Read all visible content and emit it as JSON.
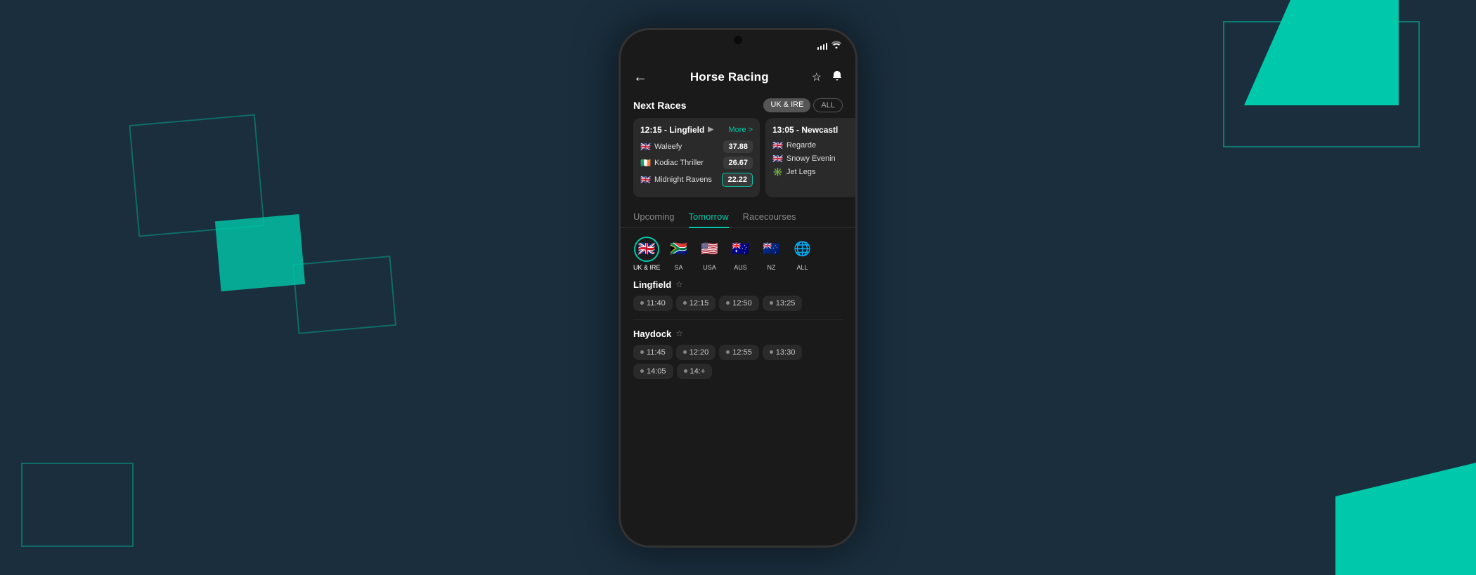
{
  "background": {
    "color": "#1a2e3d"
  },
  "app": {
    "title": "Horse Racing",
    "back_label": "←",
    "star_icon": "☆",
    "bell_icon": "🔔"
  },
  "next_races": {
    "title": "Next Races",
    "filters": [
      {
        "label": "UK & IRE",
        "active": true
      },
      {
        "label": "ALL",
        "active": false
      }
    ],
    "cards": [
      {
        "time_venue": "12:15 - Lingfield",
        "more_label": "More >",
        "horses": [
          {
            "name": "Waleefy",
            "odds": "37.88",
            "flag": "🇬🇧",
            "highlighted": false
          },
          {
            "name": "Kodiac Thriller",
            "odds": "26.67",
            "flag": "🇮🇪",
            "highlighted": false
          },
          {
            "name": "Midnight Ravens",
            "odds": "22.22",
            "flag": "🇬🇧",
            "highlighted": true
          }
        ]
      },
      {
        "time_venue": "13:05 - Newcastl",
        "more_label": "",
        "horses": [
          {
            "name": "Regarde",
            "odds": "",
            "flag": "🇬🇧",
            "highlighted": false
          },
          {
            "name": "Snowy Evenin",
            "odds": "",
            "flag": "🇬🇧",
            "highlighted": false
          },
          {
            "name": "Jet Legs",
            "odds": "",
            "flag": "✳️",
            "highlighted": false
          }
        ]
      }
    ]
  },
  "main_tabs": [
    {
      "label": "Upcoming",
      "active": false
    },
    {
      "label": "Tomorrow",
      "active": true
    },
    {
      "label": "Racecourses",
      "active": false
    }
  ],
  "country_filters": [
    {
      "label": "UK & IRE",
      "flag": "🇬🇧",
      "selected": true
    },
    {
      "label": "SA",
      "flag": "🇿🇦",
      "selected": false
    },
    {
      "label": "USA",
      "flag": "🇺🇸",
      "selected": false
    },
    {
      "label": "AUS",
      "flag": "🇦🇺",
      "selected": false
    },
    {
      "label": "NZ",
      "flag": "🇳🇿",
      "selected": false
    },
    {
      "label": "ALL",
      "flag": "🌐",
      "selected": false
    }
  ],
  "racecourses": [
    {
      "name": "Lingfield",
      "times": [
        "11:40",
        "12:15",
        "12:50",
        "13:25"
      ]
    },
    {
      "name": "Haydock",
      "times": [
        "11:45",
        "12:20",
        "12:55",
        "13:30",
        "14:05",
        "14:+"
      ]
    }
  ],
  "status_bar": {
    "signal": "●●●●",
    "wifi": "wifi"
  }
}
